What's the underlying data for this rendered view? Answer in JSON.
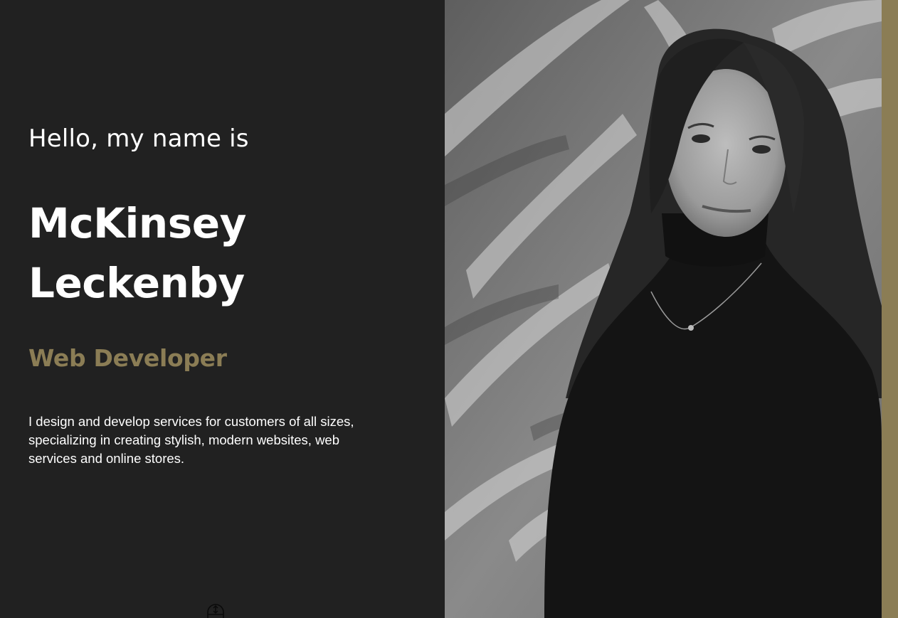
{
  "theme": {
    "background": "#212121",
    "text": "#ffffff",
    "accent": "#8b7d55"
  },
  "hero": {
    "greeting": "Hello, my name is",
    "first_name": "McKinsey",
    "last_name": "Leckenby",
    "role": "Web Developer",
    "description": "I design and develop services for customers of all sizes, specializing in creating stylish, modern websites, web services and online stores."
  },
  "icons": {
    "scroll": "scroll-mouse-icon",
    "portrait": "portrait-photo"
  }
}
